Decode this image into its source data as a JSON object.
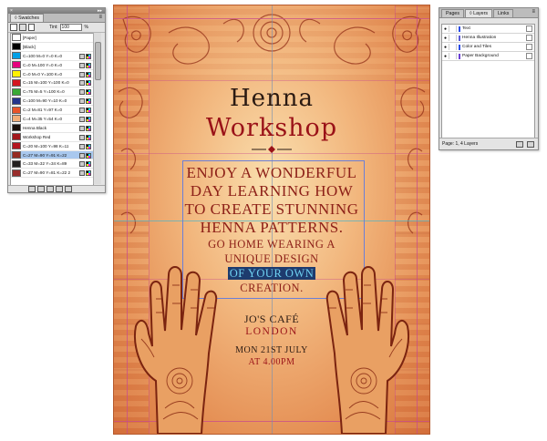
{
  "swatches_panel": {
    "tab": "◊ Swatches",
    "tint_label": "Tint:",
    "tint_value": "100",
    "tint_unit": "%",
    "swatches": [
      {
        "name": "[Paper]",
        "color": "#ffffff"
      },
      {
        "name": "[Black]",
        "color": "#000000"
      },
      {
        "name": "C=100 M=0 Y=0 K=0",
        "color": "#00a0e6"
      },
      {
        "name": "C=0 M=100 Y=0 K=0",
        "color": "#e6007e"
      },
      {
        "name": "C=0 M=0 Y=100 K=0",
        "color": "#fff200"
      },
      {
        "name": "C=15 M=100 Y=100 K=0",
        "color": "#d4141e"
      },
      {
        "name": "C=75 M=5 Y=100 K=0",
        "color": "#3aa935"
      },
      {
        "name": "C=100 M=90 Y=10 K=0",
        "color": "#25348c"
      },
      {
        "name": "C=2 M=81 Y=97 K=0",
        "color": "#e9542a"
      },
      {
        "name": "C=4 M=35 Y=54 K=0",
        "color": "#f2ad78"
      },
      {
        "name": "Henna Black",
        "color": "#1a0f0a"
      },
      {
        "name": "Workshop Red",
        "color": "#a3161b"
      },
      {
        "name": "C=20 M=100 Y=98 K=11",
        "color": "#b3151f"
      },
      {
        "name": "C=27 M=90 Y=91 K=22",
        "color": "#962b22",
        "selected": true
      },
      {
        "name": "C=33 M=32 Y=34 K=89",
        "color": "#231f1e"
      },
      {
        "name": "C=27 M=90 Y=81 K=22 2",
        "color": "#992d2c"
      }
    ]
  },
  "layers_panel": {
    "tabs": [
      "Pages",
      "◊ Layers",
      "Links"
    ],
    "layers": [
      {
        "name": "Text",
        "color": "#2a4de6"
      },
      {
        "name": "Henna Illustration",
        "color": "#5b5bd6"
      },
      {
        "name": "Color and Tiles",
        "color": "#2a4de6"
      },
      {
        "name": "Paper Background",
        "color": "#6b3fd6"
      }
    ],
    "status": "Page: 1, 4 Layers"
  },
  "poster": {
    "title_line1": "Henna",
    "title_line2": "Workshop",
    "body_big": [
      "Enjoy a wonderful",
      "day learning how",
      "to create stunning",
      "henna patterns."
    ],
    "body_small": [
      "Go home wearing a",
      "unique design"
    ],
    "highlight": "of your own",
    "body_end": "creation.",
    "venue_name": "Jo's Café",
    "venue_city": "London",
    "date": "Mon 21st July",
    "time": "at 4.00pm",
    "colors": {
      "dark": "#2b1a12",
      "red": "#9a1218",
      "body": "#8d2018",
      "highlight_bg": "#1e3b6e",
      "highlight_fg": "#6fd2f2"
    }
  }
}
